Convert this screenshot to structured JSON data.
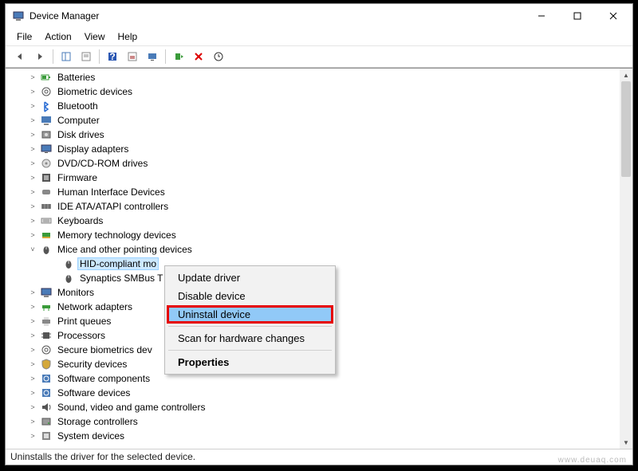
{
  "window": {
    "title": "Device Manager"
  },
  "menu": {
    "file": "File",
    "action": "Action",
    "view": "View",
    "help": "Help"
  },
  "tree": {
    "items": [
      {
        "label": "Batteries",
        "icon": "battery"
      },
      {
        "label": "Biometric devices",
        "icon": "biometric"
      },
      {
        "label": "Bluetooth",
        "icon": "bluetooth"
      },
      {
        "label": "Computer",
        "icon": "computer"
      },
      {
        "label": "Disk drives",
        "icon": "disk"
      },
      {
        "label": "Display adapters",
        "icon": "display"
      },
      {
        "label": "DVD/CD-ROM drives",
        "icon": "dvd"
      },
      {
        "label": "Firmware",
        "icon": "firmware"
      },
      {
        "label": "Human Interface Devices",
        "icon": "hid"
      },
      {
        "label": "IDE ATA/ATAPI controllers",
        "icon": "ide"
      },
      {
        "label": "Keyboards",
        "icon": "keyboard"
      },
      {
        "label": "Memory technology devices",
        "icon": "memory"
      },
      {
        "label": "Mice and other pointing devices",
        "icon": "mouse",
        "expanded": true
      },
      {
        "label": "Monitors",
        "icon": "monitor"
      },
      {
        "label": "Network adapters",
        "icon": "network"
      },
      {
        "label": "Print queues",
        "icon": "printer"
      },
      {
        "label": "Processors",
        "icon": "cpu"
      },
      {
        "label": "Secure biometrics dev",
        "icon": "biometric"
      },
      {
        "label": "Security devices",
        "icon": "security"
      },
      {
        "label": "Software components",
        "icon": "software"
      },
      {
        "label": "Software devices",
        "icon": "software"
      },
      {
        "label": "Sound, video and game controllers",
        "icon": "sound"
      },
      {
        "label": "Storage controllers",
        "icon": "storage"
      },
      {
        "label": "System devices",
        "icon": "system"
      }
    ],
    "mice_children": [
      {
        "label": "HID-compliant mo",
        "selected": true
      },
      {
        "label": "Synaptics SMBus T"
      }
    ]
  },
  "context_menu": {
    "update": "Update driver",
    "disable": "Disable device",
    "uninstall": "Uninstall device",
    "scan": "Scan for hardware changes",
    "properties": "Properties"
  },
  "statusbar": "Uninstalls the driver for the selected device.",
  "watermark": "www.deuaq.com"
}
